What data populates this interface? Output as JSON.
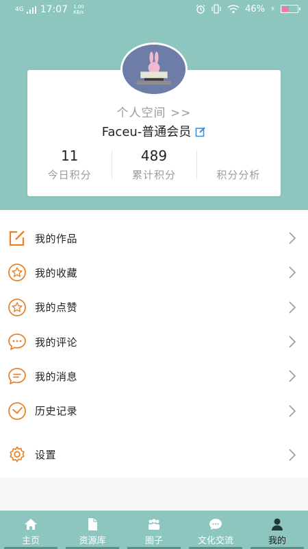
{
  "status_bar": {
    "network": "4G",
    "time": "17:07",
    "speed_value": "1.00",
    "speed_unit": "KB/s",
    "battery": "46%"
  },
  "profile": {
    "personal_space": "个人空间 >>",
    "member": "Faceu-普通会员",
    "stats": [
      {
        "value": "11",
        "label": "今日积分"
      },
      {
        "value": "489",
        "label": "累计积分"
      },
      {
        "value": "",
        "label": "积分分析"
      }
    ]
  },
  "menu": {
    "items": [
      {
        "label": "我的作品",
        "icon": "edit-icon"
      },
      {
        "label": "我的收藏",
        "icon": "star-icon"
      },
      {
        "label": "我的点赞",
        "icon": "star-icon"
      },
      {
        "label": "我的评论",
        "icon": "comment-icon"
      },
      {
        "label": "我的消息",
        "icon": "message-icon"
      },
      {
        "label": "历史记录",
        "icon": "clock-icon"
      }
    ],
    "settings": {
      "label": "设置",
      "icon": "gear-icon"
    }
  },
  "bottom_nav": {
    "items": [
      {
        "label": "主页",
        "icon": "home-icon"
      },
      {
        "label": "资源库",
        "icon": "file-icon"
      },
      {
        "label": "圈子",
        "icon": "group-icon"
      },
      {
        "label": "文化交流",
        "icon": "chat-icon"
      },
      {
        "label": "我的",
        "icon": "user-icon"
      }
    ],
    "active": "我的"
  },
  "colors": {
    "teal": "#8dc6bf",
    "orange": "#e8822a",
    "edit_blue": "#3a8fd8"
  }
}
